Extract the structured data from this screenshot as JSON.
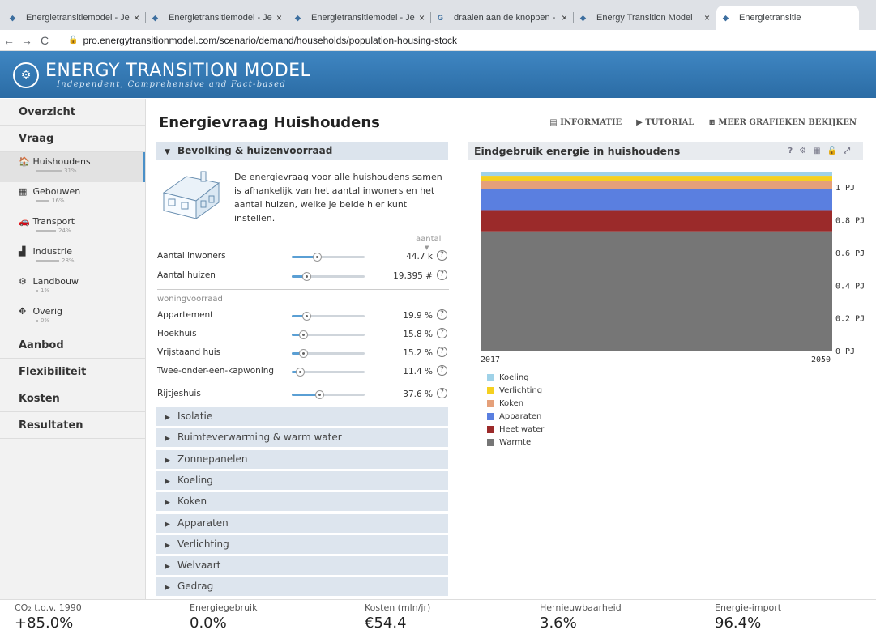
{
  "browser": {
    "tabs": [
      {
        "title": "Energietransitiemodel - Je eigen",
        "favicon": "etm-icon",
        "close": "×"
      },
      {
        "title": "Energietransitiemodel - Je eigen",
        "favicon": "etm-icon",
        "close": "×"
      },
      {
        "title": "Energietransitiemodel - Je eigen",
        "favicon": "etm-icon",
        "close": "×"
      },
      {
        "title": "draaien aan de knoppen - Googl",
        "favicon": "google-icon",
        "close": "×"
      },
      {
        "title": "Energy Transition Model",
        "favicon": "etm-icon",
        "close": "×"
      },
      {
        "title": "Energietransitie",
        "favicon": "etm-icon",
        "close": ""
      }
    ],
    "url": "pro.energytransitionmodel.com/scenario/demand/households/population-housing-stock"
  },
  "brand": {
    "name": "ENERGY TRANSITION MODEL",
    "tagline": "Independent, Comprehensive and Fact-based"
  },
  "sidebar": {
    "sections": {
      "overzicht": "Overzicht",
      "vraag": "Vraag",
      "aanbod": "Aanbod",
      "flexibiliteit": "Flexibiliteit",
      "kosten": "Kosten",
      "resultaten": "Resultaten"
    },
    "items": [
      {
        "label": "Huishoudens",
        "pct": "31%",
        "icon": "house-icon",
        "glyph": "🏠",
        "share": 0.31
      },
      {
        "label": "Gebouwen",
        "pct": "16%",
        "icon": "building-icon",
        "glyph": "▦",
        "share": 0.16
      },
      {
        "label": "Transport",
        "pct": "24%",
        "icon": "car-icon",
        "glyph": "🚗",
        "share": 0.24
      },
      {
        "label": "Industrie",
        "pct": "28%",
        "icon": "factory-icon",
        "glyph": "▟",
        "share": 0.28
      },
      {
        "label": "Landbouw",
        "pct": "1%",
        "icon": "tractor-icon",
        "glyph": "⚙",
        "share": 0.01
      },
      {
        "label": "Overig",
        "pct": "0%",
        "icon": "move-icon",
        "glyph": "✥",
        "share": 0
      }
    ]
  },
  "page": {
    "title": "Energievraag Huishoudens"
  },
  "toplinks": {
    "informatie": "INFORMATIE",
    "tutorial": "TUTORIAL",
    "meer": "MEER GRAFIEKEN BEKIJKEN"
  },
  "panel": {
    "title": "Bevolking & huizenvoorraad",
    "intro": "De energievraag voor alle huishoudens samen is afhankelijk van het aantal inwoners en het aantal huizen, welke je beide hier kunt instellen.",
    "unit_header": "aantal",
    "group_header": "woningvoorraad",
    "sliders": [
      {
        "label": "Aantal inwoners",
        "value": "44.7 k",
        "level": 0.35
      },
      {
        "label": "Aantal huizen",
        "value": "19,395 #",
        "level": 0.2
      },
      {
        "label": "Appartement",
        "value": "19.9 %",
        "level": 0.2
      },
      {
        "label": "Hoekhuis",
        "value": "15.8 %",
        "level": 0.16
      },
      {
        "label": "Vrijstaand huis",
        "value": "15.2 %",
        "level": 0.15
      },
      {
        "label": "Twee-onder-een-kapwoning",
        "value": "11.4 %",
        "level": 0.11
      },
      {
        "label": "Rijtjeshuis",
        "value": "37.6 %",
        "level": 0.38
      }
    ]
  },
  "accordions": [
    "Isolatie",
    "Ruimteverwarming & warm water",
    "Zonnepanelen",
    "Koeling",
    "Koken",
    "Apparaten",
    "Verlichting",
    "Welvaart",
    "Gedrag"
  ],
  "chart_data": {
    "type": "area",
    "title": "Eindgebruik energie in huishoudens",
    "x": [
      2017,
      2050
    ],
    "ylim": [
      0,
      1.1
    ],
    "yticks": [
      "0 PJ",
      "0.2 PJ",
      "0.4 PJ",
      "0.6 PJ",
      "0.8 PJ",
      "1 PJ"
    ],
    "ytick_values": [
      0,
      0.2,
      0.4,
      0.6,
      0.8,
      1.0
    ],
    "series": [
      {
        "name": "Warmte",
        "color": "#767676",
        "values": [
          0.73,
          0.73
        ]
      },
      {
        "name": "Heet water",
        "color": "#9b2a2a",
        "values": [
          0.13,
          0.13
        ]
      },
      {
        "name": "Apparaten",
        "color": "#5a7fe0",
        "values": [
          0.13,
          0.13
        ]
      },
      {
        "name": "Koken",
        "color": "#e5a07a",
        "values": [
          0.05,
          0.05
        ]
      },
      {
        "name": "Verlichting",
        "color": "#f5d020",
        "values": [
          0.03,
          0.03
        ]
      },
      {
        "name": "Koeling",
        "color": "#9fd2e8",
        "values": [
          0.02,
          0.02
        ]
      }
    ],
    "legend": [
      "Koeling",
      "Verlichting",
      "Koken",
      "Apparaten",
      "Heet water",
      "Warmte"
    ],
    "legend_position": "bottom-left"
  },
  "kpis": [
    {
      "label": "CO₂ t.o.v. 1990",
      "value": "+85.0%"
    },
    {
      "label": "Energiegebruik",
      "value": "0.0%"
    },
    {
      "label": "Kosten (mln/jr)",
      "value": "€54.4"
    },
    {
      "label": "Hernieuwbaarheid",
      "value": "3.6%"
    },
    {
      "label": "Energie-import",
      "value": "96.4%"
    }
  ]
}
